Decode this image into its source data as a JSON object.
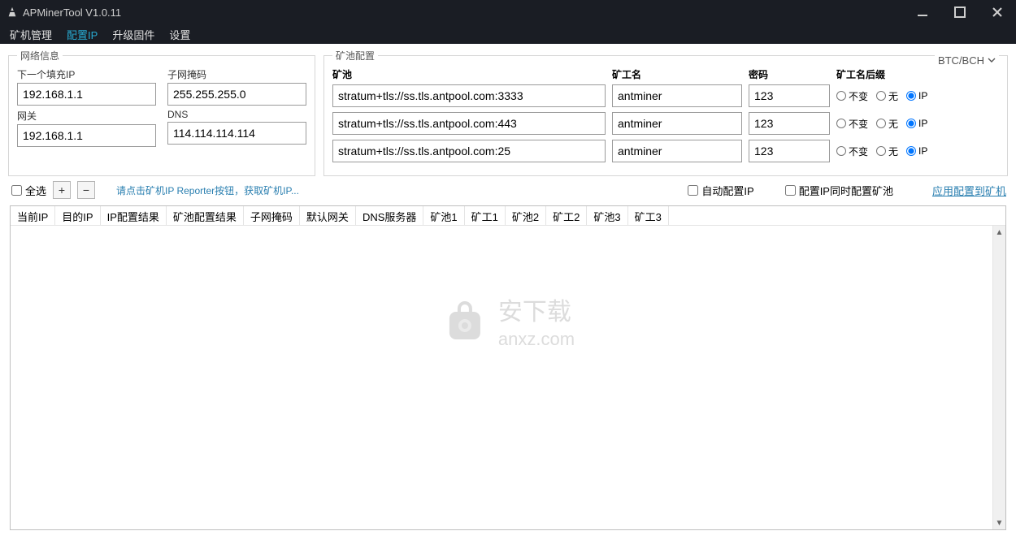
{
  "window": {
    "title": "APMinerTool V1.0.11"
  },
  "menu": {
    "items": [
      "矿机管理",
      "配置IP",
      "升级固件",
      "设置"
    ],
    "active_index": 1
  },
  "network": {
    "legend": "网络信息",
    "next_ip_label": "下一个填充IP",
    "next_ip": "192.168.1.1",
    "subnet_label": "子网掩码",
    "subnet": "255.255.255.0",
    "gateway_label": "网关",
    "gateway": "192.168.1.1",
    "dns_label": "DNS",
    "dns": "114.114.114.114"
  },
  "pool": {
    "legend": "矿池配置",
    "coin": "BTC/BCH",
    "headers": {
      "pool": "矿池",
      "worker": "矿工名",
      "password": "密码",
      "suffix": "矿工名后缀"
    },
    "suffix_options": [
      "不变",
      "无",
      "IP"
    ],
    "rows": [
      {
        "url": "stratum+tls://ss.tls.antpool.com:3333",
        "worker": "antminer",
        "password": "123",
        "suffix": "IP"
      },
      {
        "url": "stratum+tls://ss.tls.antpool.com:443",
        "worker": "antminer",
        "password": "123",
        "suffix": "IP"
      },
      {
        "url": "stratum+tls://ss.tls.antpool.com:25",
        "worker": "antminer",
        "password": "123",
        "suffix": "IP"
      }
    ]
  },
  "toolbar": {
    "select_all": "全选",
    "plus": "+",
    "minus": "−",
    "hint": "请点击矿机IP Reporter按钮，获取矿机IP...",
    "auto_config": "自动配置IP",
    "config_pool_too": "配置IP同时配置矿池",
    "apply": "应用配置到矿机"
  },
  "table": {
    "columns": [
      "当前IP",
      "目的IP",
      "IP配置结果",
      "矿池配置结果",
      "子网掩码",
      "默认网关",
      "DNS服务器",
      "矿池1",
      "矿工1",
      "矿池2",
      "矿工2",
      "矿池3",
      "矿工3"
    ]
  },
  "watermark": {
    "name": "安下载",
    "url": "anxz.com"
  }
}
